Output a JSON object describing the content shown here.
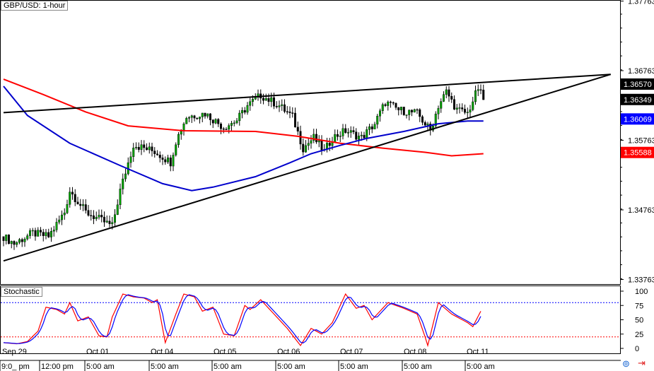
{
  "header": {
    "title": "GBP/USD: 1-hour"
  },
  "indicator": {
    "title": "Stochastic"
  },
  "chart_data": [
    {
      "type": "candlestick",
      "title": "GBP/USD: 1-hour",
      "ylim": [
        1.3376,
        1.3776
      ],
      "y_ticks": [
        "1.37763",
        "1.36763",
        "1.35763",
        "1.34763",
        "1.33763"
      ],
      "price_labels": [
        {
          "value": "1.36570",
          "color": "#000000"
        },
        {
          "value": "1.36349",
          "color": "#000000"
        },
        {
          "value": "1.36069",
          "color": "#0000ff"
        },
        {
          "value": "1.35588",
          "color": "#ff0000"
        }
      ],
      "x_date_labels": [
        "Sep 29",
        "Oct 01",
        "Oct 04",
        "Oct 05",
        "Oct 06",
        "Oct 07",
        "Oct 08",
        "Oct 11"
      ],
      "x_time_labels": [
        "9:0_ pm",
        "12:00 pm",
        "5:00 am",
        "5:00 am",
        "5:00 am",
        "5:00 am",
        "5:00 am",
        "5:00 am",
        "5:00 am"
      ],
      "colors": {
        "up": "#00a000",
        "down": "#000000",
        "ma_slow": "#ff0000",
        "ma_fast": "#0000cc",
        "trendline": "#000000"
      },
      "close_path": [
        [
          0,
          1.3438
        ],
        [
          4,
          1.3428
        ],
        [
          11,
          1.3443
        ],
        [
          17,
          1.3438
        ],
        [
          23,
          1.3473
        ],
        [
          25,
          1.3504
        ],
        [
          31,
          1.3473
        ],
        [
          36,
          1.3463
        ],
        [
          41,
          1.3453
        ],
        [
          44,
          1.3504
        ],
        [
          47,
          1.3544
        ],
        [
          49,
          1.357
        ],
        [
          53,
          1.3565
        ],
        [
          57,
          1.356
        ],
        [
          63,
          1.3545
        ],
        [
          65,
          1.3575
        ],
        [
          69,
          1.361
        ],
        [
          76,
          1.3615
        ],
        [
          83,
          1.3595
        ],
        [
          88,
          1.3605
        ],
        [
          92,
          1.3626
        ],
        [
          97,
          1.3641
        ],
        [
          104,
          1.3626
        ],
        [
          109,
          1.361
        ],
        [
          113,
          1.3565
        ],
        [
          117,
          1.358
        ],
        [
          121,
          1.356
        ],
        [
          124,
          1.358
        ],
        [
          129,
          1.359
        ],
        [
          135,
          1.358
        ],
        [
          140,
          1.36
        ],
        [
          144,
          1.3631
        ],
        [
          149,
          1.362
        ],
        [
          156,
          1.3615
        ],
        [
          161,
          1.359
        ],
        [
          164,
          1.3626
        ],
        [
          167,
          1.3646
        ],
        [
          171,
          1.362
        ],
        [
          175,
          1.3615
        ],
        [
          179,
          1.3651
        ],
        [
          181,
          1.3635
        ]
      ],
      "ma_slow": [
        [
          0,
          1.3664
        ],
        [
          15,
          1.3642
        ],
        [
          31,
          1.3617
        ],
        [
          47,
          1.3597
        ],
        [
          68,
          1.359
        ],
        [
          95,
          1.3589
        ],
        [
          111,
          1.3582
        ],
        [
          127,
          1.3572
        ],
        [
          143,
          1.3565
        ],
        [
          159,
          1.3559
        ],
        [
          169,
          1.3554
        ],
        [
          181,
          1.3557
        ]
      ],
      "ma_fast": [
        [
          0,
          1.3654
        ],
        [
          9,
          1.3612
        ],
        [
          25,
          1.3572
        ],
        [
          44,
          1.354
        ],
        [
          60,
          1.3514
        ],
        [
          71,
          1.3504
        ],
        [
          79,
          1.3509
        ],
        [
          95,
          1.3524
        ],
        [
          108,
          1.3544
        ],
        [
          116,
          1.3557
        ],
        [
          127,
          1.3569
        ],
        [
          137,
          1.3579
        ],
        [
          151,
          1.3589
        ],
        [
          164,
          1.36
        ],
        [
          175,
          1.3604
        ],
        [
          181,
          1.3604
        ]
      ],
      "trendlines": [
        {
          "name": "resistance",
          "from": [
            0,
            1.3616
          ],
          "to": [
            229,
            1.3671
          ]
        },
        {
          "name": "support",
          "from": [
            0,
            1.3403
          ],
          "to": [
            229,
            1.3671
          ]
        }
      ]
    },
    {
      "type": "line",
      "title": "Stochastic",
      "ylim": [
        0,
        100
      ],
      "y_ticks": [
        "100",
        "75",
        "50",
        "25",
        "0"
      ],
      "levels": [
        80,
        20
      ],
      "colors": {
        "k": "#ff0000",
        "d": "#0000ff",
        "upper_level": "#0000ff",
        "lower_level": "#ff0000"
      },
      "k": [
        [
          0,
          10
        ],
        [
          5,
          8
        ],
        [
          9,
          12
        ],
        [
          13,
          30
        ],
        [
          16,
          72
        ],
        [
          20,
          68
        ],
        [
          23,
          60
        ],
        [
          25,
          80
        ],
        [
          28,
          48
        ],
        [
          32,
          55
        ],
        [
          36,
          22
        ],
        [
          39,
          20
        ],
        [
          41,
          55
        ],
        [
          45,
          95
        ],
        [
          49,
          90
        ],
        [
          53,
          88
        ],
        [
          56,
          80
        ],
        [
          58,
          85
        ],
        [
          61,
          10
        ],
        [
          65,
          60
        ],
        [
          68,
          95
        ],
        [
          72,
          90
        ],
        [
          75,
          65
        ],
        [
          79,
          72
        ],
        [
          83,
          25
        ],
        [
          87,
          22
        ],
        [
          91,
          75
        ],
        [
          93,
          68
        ],
        [
          97,
          85
        ],
        [
          103,
          55
        ],
        [
          107,
          35
        ],
        [
          112,
          5
        ],
        [
          116,
          35
        ],
        [
          120,
          25
        ],
        [
          124,
          45
        ],
        [
          129,
          95
        ],
        [
          133,
          70
        ],
        [
          136,
          75
        ],
        [
          139,
          50
        ],
        [
          141,
          60
        ],
        [
          145,
          80
        ],
        [
          151,
          70
        ],
        [
          156,
          60
        ],
        [
          159,
          20
        ],
        [
          160,
          5
        ],
        [
          164,
          80
        ],
        [
          169,
          60
        ],
        [
          175,
          45
        ],
        [
          177,
          38
        ],
        [
          180,
          65
        ]
      ]
    }
  ]
}
